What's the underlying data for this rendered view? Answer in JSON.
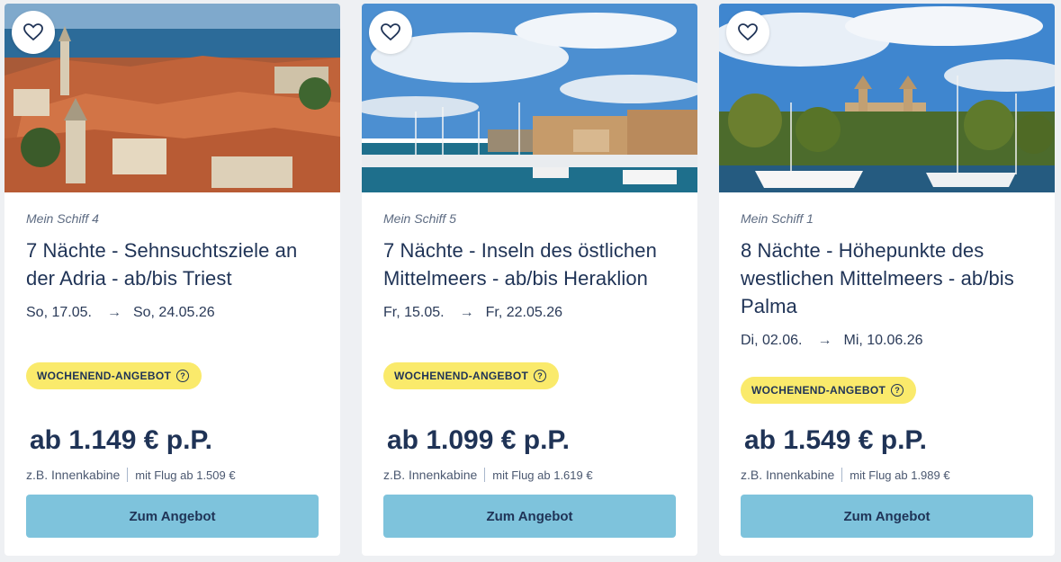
{
  "cards": [
    {
      "ship": "Mein Schiff 4",
      "title": "7 Nächte - Sehnsuchtsziele an der Adria - ab/bis Triest",
      "date_from": "So, 17.05.",
      "date_to": "So, 24.05.26",
      "badge": "WOCHENEND-ANGEBOT",
      "price": "ab 1.149 € p.P.",
      "cabin": "z.B. Innenkabine",
      "flight": "mit Flug ab 1.509 €",
      "cta": "Zum Angebot"
    },
    {
      "ship": "Mein Schiff 5",
      "title": "7 Nächte - Inseln des östlichen Mittelmeers - ab/bis Heraklion",
      "date_from": "Fr, 15.05.",
      "date_to": "Fr, 22.05.26",
      "badge": "WOCHENEND-ANGEBOT",
      "price": "ab 1.099 € p.P.",
      "cabin": "z.B. Innenkabine",
      "flight": "mit Flug ab 1.619 €",
      "cta": "Zum Angebot"
    },
    {
      "ship": "Mein Schiff 1",
      "title": "8 Nächte - Höhepunkte des westlichen Mittelmeers - ab/bis Palma",
      "date_from": "Di, 02.06.",
      "date_to": "Mi, 10.06.26",
      "badge": "WOCHENEND-ANGEBOT",
      "price": "ab 1.549 € p.P.",
      "cabin": "z.B. Innenkabine",
      "flight": "mit Flug ab 1.989 €",
      "cta": "Zum Angebot"
    }
  ],
  "icons": {
    "favorite": "heart-icon",
    "date_arrow": "arrow-right-icon",
    "badge_help": "question-circle-icon"
  },
  "colors": {
    "navy": "#1f3356",
    "badge": "#faea6b",
    "cta": "#7ec3dc"
  }
}
